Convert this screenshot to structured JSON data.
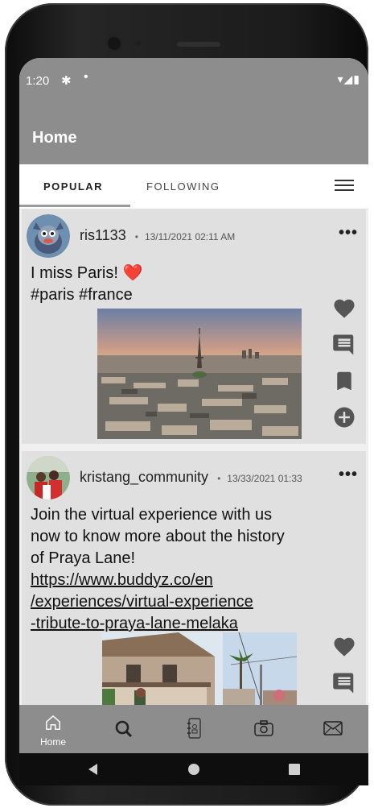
{
  "status_bar": {
    "time": "1:20",
    "gear": "✱",
    "dot": "•",
    "icons": "▾◢▮"
  },
  "app_bar": {
    "title": "Home"
  },
  "tabs": [
    {
      "label": "POPULAR"
    },
    {
      "label": "FOLLOWING"
    }
  ],
  "posts": [
    {
      "username": "ris1133",
      "separator": "•",
      "date": "13/11/2021 02:11 AM",
      "more": "•••",
      "text_line1": "I miss Paris! ❤️",
      "text_line2": "#paris #france"
    },
    {
      "username": "kristang_community",
      "separator": "•",
      "date": "13/33/2021 01:33",
      "more": "•••",
      "text_line1": "Join the virtual experience with us",
      "text_line2": "now to know more about the history",
      "text_line3": "of Praya Lane!",
      "link_line1": "https://www.buddyz.co/en",
      "link_line2": "/experiences/virtual-experience",
      "link_line3": "-tribute-to-praya-lane-melaka"
    }
  ],
  "bottom_nav": {
    "home_label": "Home"
  },
  "colors": {
    "bar_gray": "#8d8d8d",
    "card_gray": "#e0e0e0",
    "icon_dark": "#555555"
  }
}
